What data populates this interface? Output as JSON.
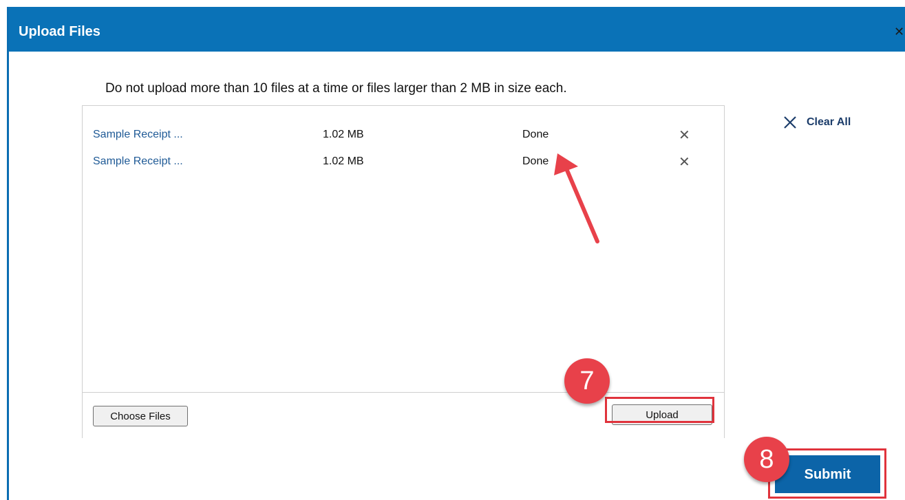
{
  "dialog": {
    "title": "Upload Files",
    "close_glyph": "✕",
    "notice": "Do not upload more than 10 files at a time or files larger than 2 MB in size each.",
    "clear_all_label": "Clear All",
    "clear_all_icon": "close-icon"
  },
  "files": [
    {
      "name": "Sample Receipt ...",
      "size": "1.02 MB",
      "status": "Done",
      "remove_glyph": "✕"
    },
    {
      "name": "Sample Receipt ...",
      "size": "1.02 MB",
      "status": "Done",
      "remove_glyph": "✕"
    }
  ],
  "footer": {
    "choose_label": "Choose Files",
    "upload_label": "Upload"
  },
  "actions": {
    "submit_label": "Submit"
  },
  "annotations": {
    "step_upload": "7",
    "step_submit": "8",
    "highlight_color": "#e0333c",
    "badge_color": "#e8414a"
  },
  "colors": {
    "titlebar": "#0a72b7",
    "link": "#1f5a96",
    "submit": "#0c64a8"
  }
}
